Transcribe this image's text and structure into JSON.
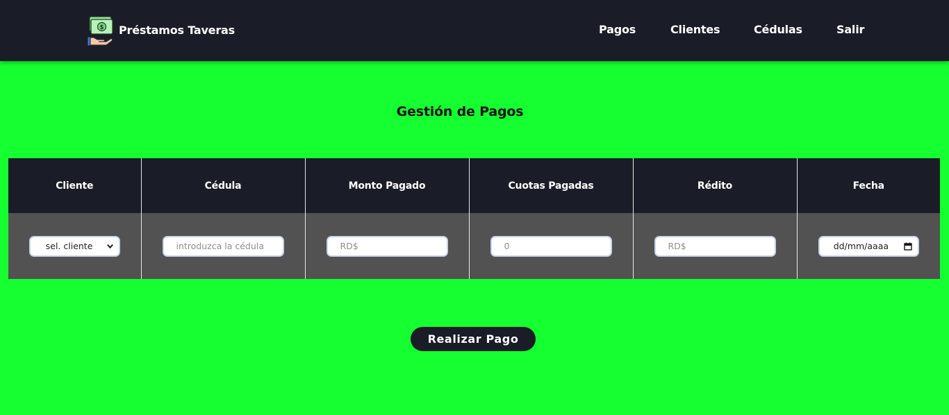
{
  "navbar": {
    "brand_name": "Préstamos Taveras",
    "logo_icon": "money-hand-icon",
    "links": [
      "Pagos",
      "Clientes",
      "Cédulas",
      "Salir"
    ]
  },
  "main": {
    "title": "Gestión de Pagos",
    "table": {
      "headers": [
        "Cliente",
        "Cédula",
        "Monto Pagado",
        "Cuotas Pagadas",
        "Rédito",
        "Fecha"
      ],
      "client_select_value": "sel. cliente",
      "cedula_placeholder": "introduzca la cédula",
      "monto_placeholder": "RD$",
      "cuotas_placeholder": "0",
      "redito_placeholder": "RD$",
      "fecha_placeholder": "dd/mm/aaaa"
    },
    "submit_label": "Realizar Pago"
  },
  "colors": {
    "background": "#16ff30",
    "navbar": "#1a1d28",
    "table_header": "#1a1d28",
    "table_row": "#525252",
    "button": "#1a1d28"
  }
}
